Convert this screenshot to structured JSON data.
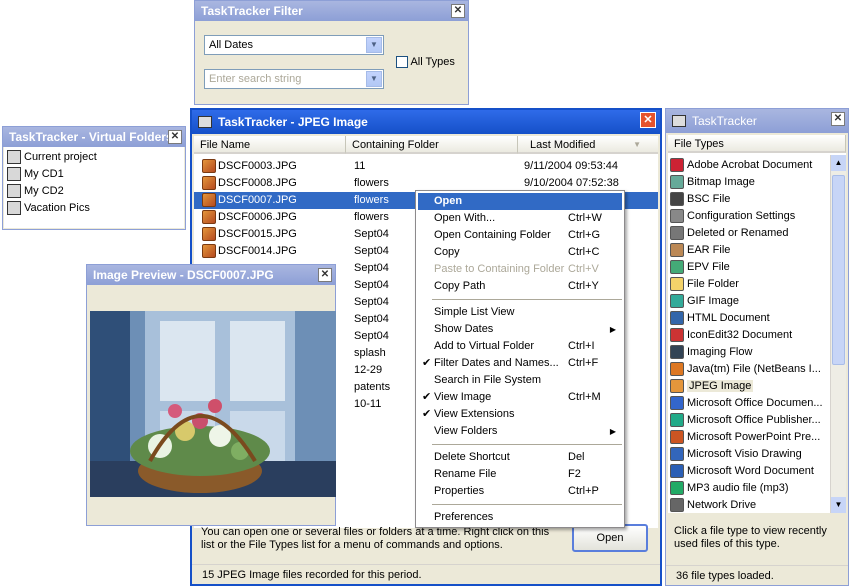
{
  "filter": {
    "title": "TaskTracker Filter",
    "dates_value": "All Dates",
    "search_placeholder": "Enter search string",
    "all_types_label": "All Types"
  },
  "virtual": {
    "title": "TaskTracker - Virtual Folders",
    "items": [
      "Current project",
      "My CD1",
      "My CD2",
      "Vacation Pics"
    ]
  },
  "main": {
    "title": "TaskTracker - JPEG Image",
    "columns": [
      "File Name",
      "Containing Folder",
      "Last Modified"
    ],
    "rows": [
      {
        "name": "DSCF0003.JPG",
        "folder": "11",
        "date": "9/11/2004 09:53:44"
      },
      {
        "name": "DSCF0008.JPG",
        "folder": "flowers",
        "date": "9/10/2004 07:52:38"
      },
      {
        "name": "DSCF0007.JPG",
        "folder": "flowers",
        "date": ""
      },
      {
        "name": "DSCF0006.JPG",
        "folder": "flowers",
        "date": ""
      },
      {
        "name": "DSCF0015.JPG",
        "folder": "Sept04",
        "date": ""
      },
      {
        "name": "DSCF0014.JPG",
        "folder": "Sept04",
        "date": ""
      },
      {
        "name": "",
        "folder": "Sept04",
        "date": ""
      },
      {
        "name": "",
        "folder": "Sept04",
        "date": ""
      },
      {
        "name": "",
        "folder": "Sept04",
        "date": ""
      },
      {
        "name": "",
        "folder": "Sept04",
        "date": ""
      },
      {
        "name": "",
        "folder": "Sept04",
        "date": ""
      },
      {
        "name": "",
        "folder": "splash",
        "date": ""
      },
      {
        "name": "",
        "folder": "12-29",
        "date": ""
      },
      {
        "name": "",
        "folder": "patents",
        "date": ""
      },
      {
        "name": "",
        "folder": "10-11",
        "date": ""
      }
    ],
    "info_text": "You can open one or several files or folders at a time. Right click on this list or the File Types list for a menu of commands and options.",
    "open_label": "Open",
    "status": "15 JPEG Image files recorded for this period."
  },
  "preview": {
    "title": "Image Preview - DSCF0007.JPG"
  },
  "context_menu": [
    {
      "label": "Open",
      "shortcut": "",
      "state": "highlight"
    },
    {
      "label": "Open With...",
      "shortcut": "Ctrl+W"
    },
    {
      "label": "Open Containing Folder",
      "shortcut": "Ctrl+G"
    },
    {
      "label": "Copy",
      "shortcut": "Ctrl+C"
    },
    {
      "label": "Paste to Containing Folder",
      "shortcut": "Ctrl+V",
      "state": "disabled"
    },
    {
      "label": "Copy Path",
      "shortcut": "Ctrl+Y"
    },
    {
      "sep": true
    },
    {
      "label": "Simple List View",
      "shortcut": ""
    },
    {
      "label": "Show Dates",
      "shortcut": "",
      "submenu": true
    },
    {
      "label": "Add to Virtual Folder",
      "shortcut": "Ctrl+I"
    },
    {
      "label": "Filter Dates and Names...",
      "shortcut": "Ctrl+F",
      "checked": true
    },
    {
      "label": "Search in File System",
      "shortcut": ""
    },
    {
      "label": "View Image",
      "shortcut": "Ctrl+M",
      "checked": true
    },
    {
      "label": "View Extensions",
      "shortcut": "",
      "checked": true
    },
    {
      "label": "View Folders",
      "shortcut": "",
      "submenu": true
    },
    {
      "sep": true
    },
    {
      "label": "Delete Shortcut",
      "shortcut": "Del"
    },
    {
      "label": "Rename File",
      "shortcut": "F2"
    },
    {
      "label": "Properties",
      "shortcut": "Ctrl+P"
    },
    {
      "sep": true
    },
    {
      "label": "Preferences",
      "shortcut": ""
    }
  ],
  "types": {
    "title": "TaskTracker",
    "column": "File Types",
    "items": [
      "Adobe Acrobat Document",
      "Bitmap Image",
      "BSC File",
      "Configuration Settings",
      "Deleted or Renamed",
      "EAR File",
      "EPV File",
      "File Folder",
      "GIF Image",
      "HTML Document",
      "IconEdit32 Document",
      "Imaging Flow",
      "Java(tm) File (NetBeans I...",
      "JPEG Image",
      "Microsoft Office Documen...",
      "Microsoft Office Publisher...",
      "Microsoft PowerPoint Pre...",
      "Microsoft Visio Drawing",
      "Microsoft Word Document",
      "MP3 audio file (mp3)",
      "Network Drive"
    ],
    "selected_index": 13,
    "info_text": "Click a file type to view recently used files of this type.",
    "status": "36 file types loaded."
  },
  "colors": {
    "titlebar_active": "#1550c8",
    "titlebar_inactive": "#8d9fd6",
    "selection": "#316ac5",
    "window_bg": "#ece9d8"
  }
}
